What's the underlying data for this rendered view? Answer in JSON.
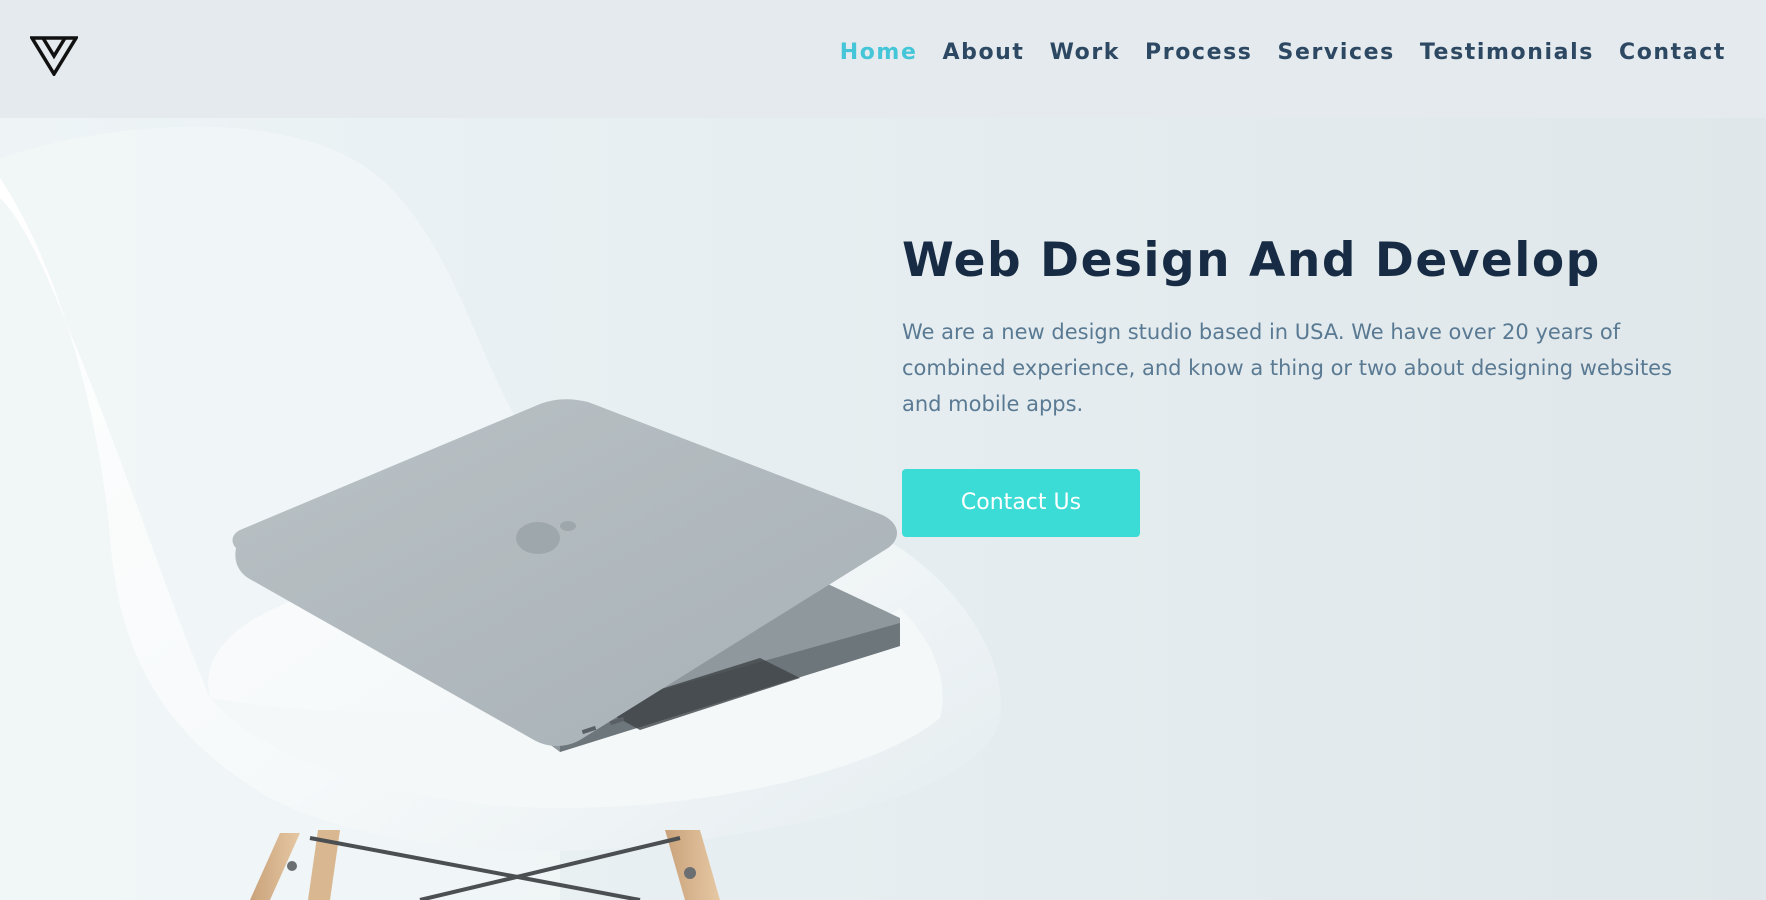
{
  "nav": {
    "items": [
      {
        "label": "Home",
        "active": true
      },
      {
        "label": "About",
        "active": false
      },
      {
        "label": "Work",
        "active": false
      },
      {
        "label": "Process",
        "active": false
      },
      {
        "label": "Services",
        "active": false
      },
      {
        "label": "Testimonials",
        "active": false
      },
      {
        "label": "Contact",
        "active": false
      }
    ]
  },
  "hero": {
    "title": "Web Design And Develop",
    "description": "We are a new design studio based in USA. We have over 20 years of combined experience, and know a thing or two about designing websites and mobile apps.",
    "cta_label": "Contact Us"
  },
  "colors": {
    "accent": "#45c6d8",
    "button": "#3cdcd6",
    "heading": "#172c44",
    "nav_text": "#2c4862",
    "body_text": "#5a7a93"
  },
  "icons": {
    "logo": "triangle-logo-icon"
  }
}
